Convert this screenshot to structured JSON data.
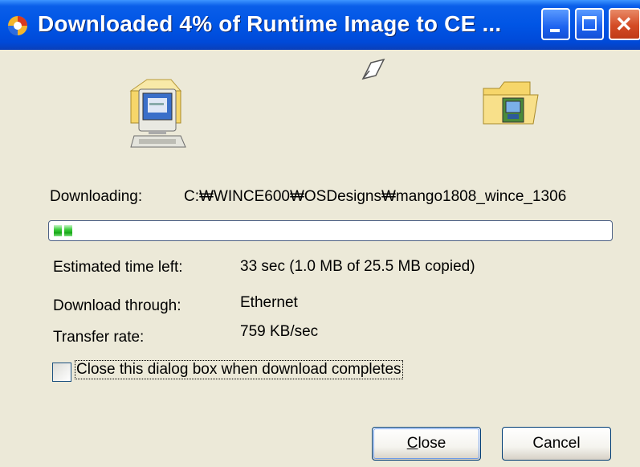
{
  "window": {
    "title": "Downloaded 4% of Runtime Image to CE ...",
    "minimize_icon": "minimize-icon",
    "maximize_icon": "maximize-icon",
    "close_icon": "close-icon"
  },
  "icons": {
    "source": "computer-icon",
    "transfer": "flying-paper-icon",
    "destination": "device-folder-icon"
  },
  "download": {
    "label": "Downloading:",
    "path": "C:₩WINCE600₩OSDesigns₩mango1808_wince_1306",
    "progress_percent": 4
  },
  "details": {
    "estimated_label": "Estimated time left:",
    "estimated_value": "33 sec (1.0 MB of 25.5 MB copied)",
    "through_label": "Download through:",
    "through_value": "Ethernet",
    "rate_label": "Transfer rate:",
    "rate_value": "759 KB/sec"
  },
  "options": {
    "close_when_done_label": "Close this dialog box when download completes",
    "close_when_done_checked": false
  },
  "buttons": {
    "close_mnemonic": "C",
    "close_rest": "lose",
    "cancel": "Cancel"
  },
  "colors": {
    "titlebar": "#0055e5",
    "dialog_bg": "#ece9d8",
    "progress": "#1aa81a"
  }
}
